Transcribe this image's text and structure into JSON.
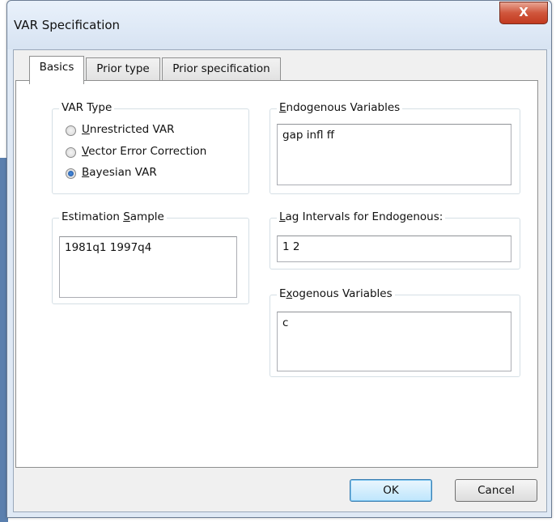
{
  "window": {
    "title": "VAR Specification",
    "close_glyph": "X"
  },
  "tabs": [
    {
      "label": "Basics",
      "active": true
    },
    {
      "label": "Prior type",
      "active": false
    },
    {
      "label": "Prior specification",
      "active": false
    }
  ],
  "var_type": {
    "legend": "VAR Type",
    "options": [
      {
        "mnemonic": "U",
        "rest": "nrestricted VAR",
        "selected": false
      },
      {
        "mnemonic": "V",
        "rest": "ector Error Correction",
        "selected": false
      },
      {
        "mnemonic": "B",
        "rest": "ayesian VAR",
        "selected": true
      }
    ]
  },
  "estimation_sample": {
    "legend_prefix": "Estimation ",
    "legend_mnemonic": "S",
    "legend_rest": "ample",
    "value": "1981q1 1997q4"
  },
  "endogenous": {
    "legend_mnemonic": "E",
    "legend_rest": "ndogenous Variables",
    "value": "gap infl ff"
  },
  "lag_intervals": {
    "legend_mnemonic": "L",
    "legend_rest": "ag Intervals for Endogenous:",
    "value": "1 2"
  },
  "exogenous": {
    "legend_prefix": "E",
    "legend_mnemonic": "x",
    "legend_rest": "ogenous Variables",
    "value": "c"
  },
  "buttons": {
    "ok": "OK",
    "cancel": "Cancel"
  }
}
